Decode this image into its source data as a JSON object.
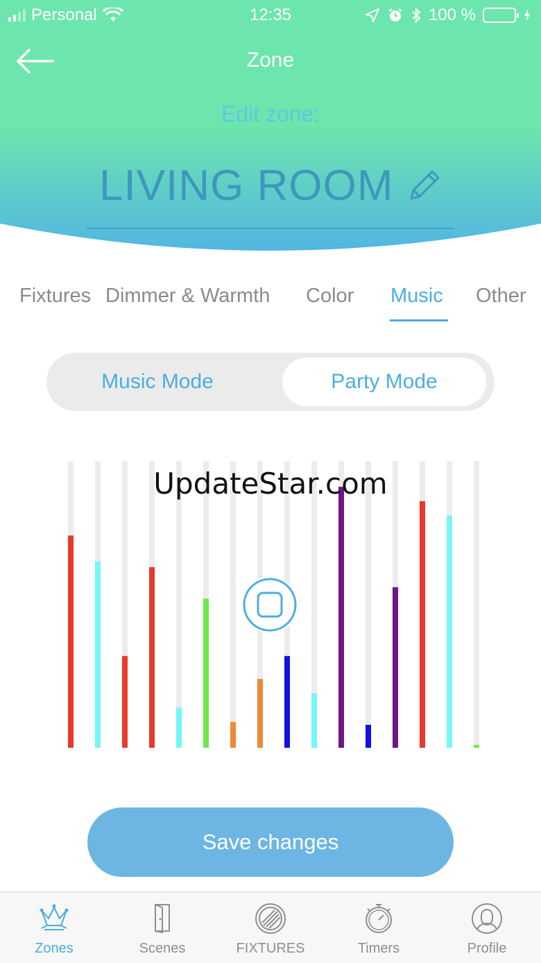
{
  "status_bar": {
    "carrier": "Personal",
    "time": "12:35",
    "battery": "100 %"
  },
  "header": {
    "title": "Zone",
    "edit_label": "Edit zone:",
    "zone_name": "LIVING ROOM"
  },
  "tabs": [
    {
      "label": "Fixtures",
      "active": false
    },
    {
      "label": "Dimmer & Warmth",
      "active": false
    },
    {
      "label": "Color",
      "active": false
    },
    {
      "label": "Music",
      "active": true
    },
    {
      "label": "Other",
      "active": false
    }
  ],
  "mode_toggle": {
    "music_mode": "Music Mode",
    "party_mode": "Party Mode",
    "selected": "Party Mode"
  },
  "equalizer": {
    "levels": [
      0.74,
      0.65,
      0.32,
      0.63,
      0.14,
      0.52,
      0.09,
      0.24,
      0.32,
      0.19,
      0.91,
      0.08,
      0.56,
      0.86,
      0.81,
      0.01
    ],
    "colors": [
      "#e8392b",
      "#74f7f7",
      "#e8392b",
      "#e8392b",
      "#74f7f7",
      "#6be84a",
      "#ec8a35",
      "#ec8a35",
      "#1111e0",
      "#74f7f7",
      "#6e1585",
      "#1111e0",
      "#6e1585",
      "#e8392b",
      "#74f7f7",
      "#6be84a"
    ],
    "track_color": "#ececec"
  },
  "watermark": "UpdateStar.com",
  "save_button": "Save changes",
  "bottom_nav": [
    {
      "label": "Zones",
      "icon": "crown-icon",
      "active": true
    },
    {
      "label": "Scenes",
      "icon": "door-icon",
      "active": false
    },
    {
      "label": "FIXTURES",
      "icon": "fixture-disc-icon",
      "active": false
    },
    {
      "label": "Timers",
      "icon": "stopwatch-icon",
      "active": false
    },
    {
      "label": "Profile",
      "icon": "profile-icon",
      "active": false
    }
  ],
  "colors": {
    "header_green": "#6ce6ac",
    "header_blue": "#55b8e2",
    "accent": "#4aaee0"
  }
}
